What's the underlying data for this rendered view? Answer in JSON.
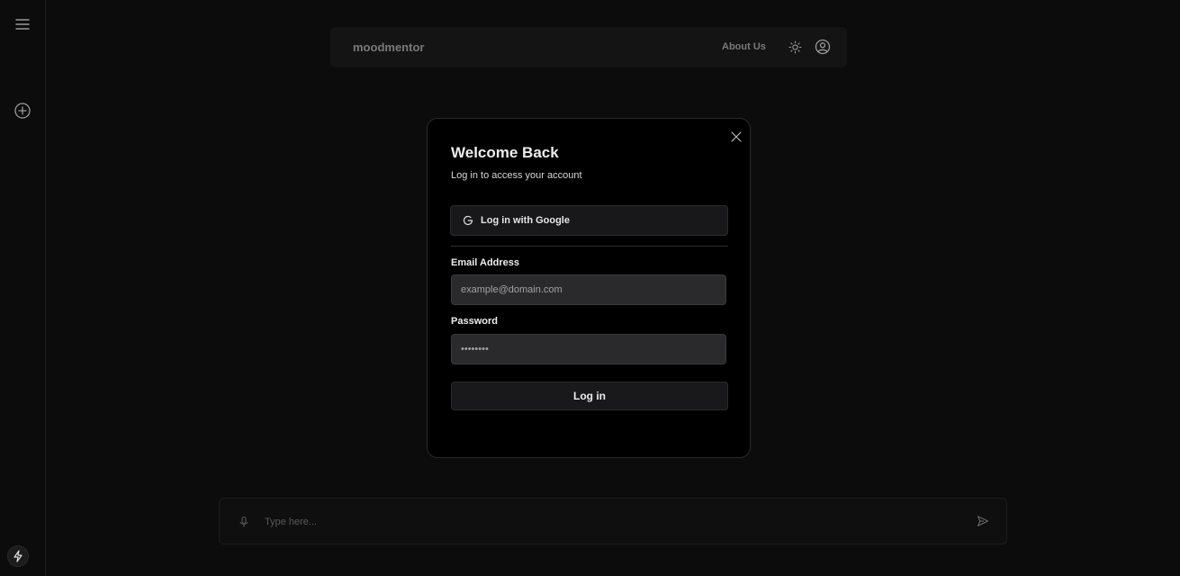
{
  "sidebar": {
    "menu_icon": "hamburger-menu-icon",
    "new_chat_icon": "plus-circle-icon",
    "bolt_icon": "lightning-bolt-icon"
  },
  "header": {
    "brand": "moodmentor",
    "about_label": "About Us",
    "theme_icon": "sun-icon",
    "user_icon": "user-circle-icon"
  },
  "chat": {
    "placeholder": "Type here...",
    "mic_icon": "microphone-icon",
    "send_icon": "send-icon"
  },
  "login_modal": {
    "title": "Welcome Back",
    "subtitle": "Log in to access your account",
    "google_label": "Log in with Google",
    "email_label": "Email Address",
    "email_placeholder": "example@domain.com",
    "password_label": "Password",
    "password_placeholder": "••••••••",
    "submit_label": "Log in",
    "close_icon": "close-icon"
  },
  "colors": {
    "background": "#0b0b0b",
    "modal_bg": "#000000",
    "input_bg": "#2a2a2c",
    "muted_text": "#7a7a7a"
  }
}
